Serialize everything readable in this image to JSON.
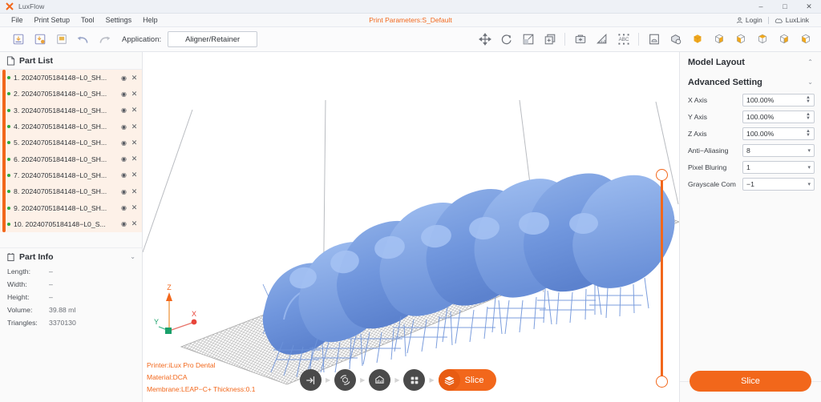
{
  "window": {
    "app_title": "LuxFlow",
    "logo_icon": "lux-x-logo-icon",
    "controls": {
      "minimize": "–",
      "maximize": "□",
      "close": "✕"
    }
  },
  "menubar": {
    "items": [
      {
        "label": "File",
        "name": "menu-file"
      },
      {
        "label": "Print Setup",
        "name": "menu-print-setup"
      },
      {
        "label": "Tool",
        "name": "menu-tool"
      },
      {
        "label": "Settings",
        "name": "menu-settings"
      },
      {
        "label": "Help",
        "name": "menu-help"
      }
    ],
    "print_parameters": "Print Parameters:S_Default",
    "account": {
      "login_label": "Login",
      "luxlink_label": "LuxLink"
    }
  },
  "toolbar": {
    "left_buttons": [
      {
        "name": "import-model-button",
        "icon": "import-icon"
      },
      {
        "name": "import-with-settings-button",
        "icon": "import-settings-icon"
      },
      {
        "name": "save-project-button",
        "icon": "save-icon"
      }
    ],
    "history_buttons": [
      {
        "name": "undo-button",
        "icon": "undo-arrow-icon"
      },
      {
        "name": "redo-button",
        "icon": "redo-arrow-icon"
      }
    ],
    "application_label": "Application:",
    "application_value": "Aligner/Retainer",
    "right_buttons": [
      {
        "name": "move-tool-button",
        "icon": "move-arrows-icon"
      },
      {
        "name": "rotate-tool-button",
        "icon": "rotate-icon"
      },
      {
        "name": "scale-tool-button",
        "icon": "scale-icon"
      },
      {
        "name": "duplicate-tool-button",
        "icon": "duplicate-icon"
      },
      {
        "name": "support-tool-button",
        "icon": "toolbox-icon"
      },
      {
        "name": "measure-tool-button",
        "icon": "ruler-icon"
      },
      {
        "name": "label-text-tool-button",
        "icon": "abc-text-icon"
      },
      {
        "name": "platform-view-button",
        "icon": "platform-frame-icon"
      },
      {
        "name": "inspect-model-button",
        "icon": "model-inspect-icon"
      },
      {
        "name": "view-solid-button",
        "icon": "cube-solid-icon"
      },
      {
        "name": "view-front-button",
        "icon": "cube-front-icon"
      },
      {
        "name": "view-left-button",
        "icon": "cube-left-icon"
      },
      {
        "name": "view-right-button",
        "icon": "cube-right-icon"
      },
      {
        "name": "view-top-button",
        "icon": "cube-top-icon"
      },
      {
        "name": "view-bottom-button",
        "icon": "cube-bottom-icon"
      }
    ]
  },
  "part_list": {
    "title": "Part List",
    "icon": "document-list-icon",
    "items": [
      {
        "index": "1.",
        "name": "20240705184148−L0_SH..."
      },
      {
        "index": "2.",
        "name": "20240705184148−L0_SH..."
      },
      {
        "index": "3.",
        "name": "20240705184148−L0_SH..."
      },
      {
        "index": "4.",
        "name": "20240705184148−L0_SH..."
      },
      {
        "index": "5.",
        "name": "20240705184148−L0_SH..."
      },
      {
        "index": "6.",
        "name": "20240705184148−L0_SH..."
      },
      {
        "index": "7.",
        "name": "20240705184148−L0_SH..."
      },
      {
        "index": "8.",
        "name": "20240705184148−L0_SH..."
      },
      {
        "index": "9.",
        "name": "20240705184148−L0_SH..."
      },
      {
        "index": "10.",
        "name": "20240705184148−L0_S..."
      }
    ],
    "eye_glyph": "◉",
    "close_glyph": "✕"
  },
  "part_info": {
    "title": "Part Info",
    "icon": "cube-info-icon",
    "rows": [
      {
        "key": "Length:",
        "value": "–"
      },
      {
        "key": "Width:",
        "value": "–"
      },
      {
        "key": "Height:",
        "value": "–"
      },
      {
        "key": "Volume:",
        "value": "39.88 ml"
      },
      {
        "key": "Triangles:",
        "value": "3370130"
      }
    ]
  },
  "viewport": {
    "axis_gizmo": {
      "x_label": "X",
      "y_label": "Y",
      "z_label": "Z"
    },
    "printer_info": [
      "Printer:iLux Pro Dental",
      "Material:DCA",
      "Membrane:LEAP−C+ Thickness:0.1"
    ],
    "steps": [
      {
        "name": "step-import",
        "icon": "import-arrow-icon"
      },
      {
        "name": "step-orient",
        "icon": "orient-rotate-icon"
      },
      {
        "name": "step-support",
        "icon": "support-structure-icon"
      },
      {
        "name": "step-layout",
        "icon": "grid-layout-icon"
      }
    ],
    "step_arrow": "▶",
    "slice_button_label": "Slice",
    "slice_button_icon": "layers-icon"
  },
  "right_panel": {
    "model_layout_title": "Model Layout",
    "advanced_setting_title": "Advanced Setting",
    "chevron_up": "⌃",
    "chevron_down": "⌄",
    "fields": [
      {
        "label": "X Axis",
        "value": "100.00%",
        "type": "spinner",
        "name": "x-axis-input"
      },
      {
        "label": "Y Axis",
        "value": "100.00%",
        "type": "spinner",
        "name": "y-axis-input"
      },
      {
        "label": "Z Axis",
        "value": "100.00%",
        "type": "spinner",
        "name": "z-axis-input"
      },
      {
        "label": "Anti−Aliasing",
        "value": "8",
        "type": "select",
        "name": "anti-aliasing-select"
      },
      {
        "label": "Pixel Bluring",
        "value": "1",
        "type": "select",
        "name": "pixel-bluring-select"
      },
      {
        "label": "Grayscale Com",
        "value": "−1",
        "type": "select",
        "name": "grayscale-com-select"
      }
    ],
    "slice_label": "Slice"
  },
  "colors": {
    "accent": "#f2671b",
    "model_blue": "#7a9fe0",
    "panel_bg": "#fafafa",
    "partlist_bg": "#fdf1e8",
    "step_dark": "#4a4a4a"
  }
}
